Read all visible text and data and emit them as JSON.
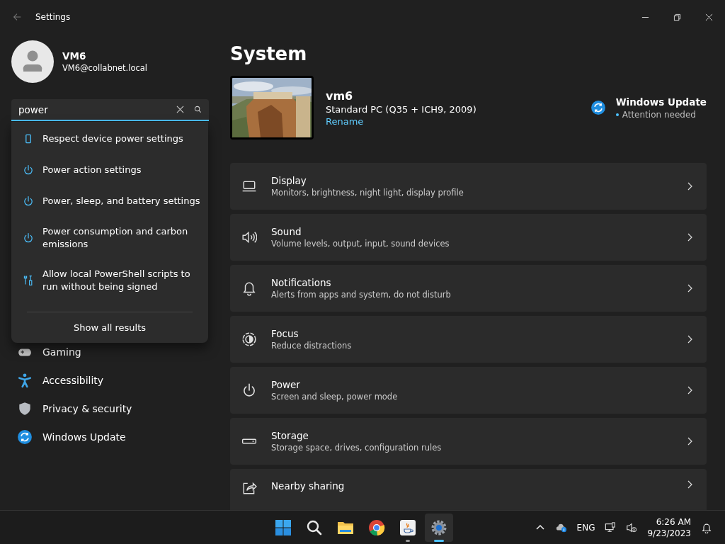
{
  "window": {
    "title": "Settings"
  },
  "account": {
    "name": "VM6",
    "email": "VM6@collabnet.local"
  },
  "search": {
    "value": "power"
  },
  "search_results": [
    {
      "text": "Respect device power settings",
      "kind": "device"
    },
    {
      "text": "Power action settings",
      "kind": "power"
    },
    {
      "text": "Power, sleep, and battery settings",
      "kind": "power"
    },
    {
      "text": "Power consumption and carbon emissions",
      "kind": "power"
    },
    {
      "text": "Allow local PowerShell scripts to run without being signed",
      "kind": "tools"
    }
  ],
  "show_all": "Show all results",
  "sidebar": {
    "items": [
      {
        "label": "Gaming",
        "kind": "gaming"
      },
      {
        "label": "Accessibility",
        "kind": "accessibility"
      },
      {
        "label": "Privacy & security",
        "kind": "shield"
      },
      {
        "label": "Windows Update",
        "kind": "update"
      }
    ]
  },
  "page": {
    "title": "System"
  },
  "device": {
    "name": "vm6",
    "model": "Standard PC (Q35 + ICH9, 2009)",
    "rename": "Rename"
  },
  "update_status": {
    "title": "Windows Update",
    "status": "Attention needed"
  },
  "settings": [
    {
      "title": "Display",
      "subtitle": "Monitors, brightness, night light, display profile",
      "kind": "display"
    },
    {
      "title": "Sound",
      "subtitle": "Volume levels, output, input, sound devices",
      "kind": "sound"
    },
    {
      "title": "Notifications",
      "subtitle": "Alerts from apps and system, do not disturb",
      "kind": "bell"
    },
    {
      "title": "Focus",
      "subtitle": "Reduce distractions",
      "kind": "focus"
    },
    {
      "title": "Power",
      "subtitle": "Screen and sleep, power mode",
      "kind": "power"
    },
    {
      "title": "Storage",
      "subtitle": "Storage space, drives, configuration rules",
      "kind": "storage"
    },
    {
      "title": "Nearby sharing",
      "kind": "share"
    }
  ],
  "taskbar": {
    "apps": [
      {
        "kind": "start",
        "running": false,
        "active": false
      },
      {
        "kind": "search",
        "running": false,
        "active": false
      },
      {
        "kind": "folder",
        "running": false,
        "active": false
      },
      {
        "kind": "browser",
        "running": false,
        "active": false
      },
      {
        "kind": "java",
        "running": true,
        "active": false
      },
      {
        "kind": "settings",
        "running": true,
        "active": true
      }
    ],
    "language": "ENG",
    "time": "6:26 AM",
    "date": "9/23/2023"
  }
}
